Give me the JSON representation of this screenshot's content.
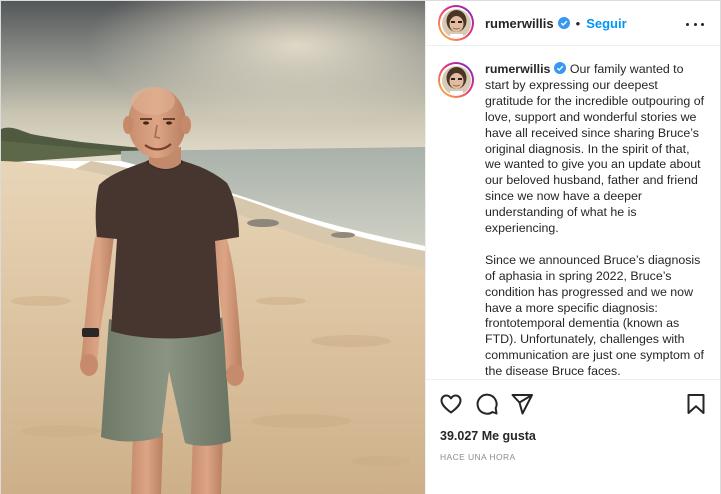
{
  "post": {
    "username": "rumerwillis",
    "follow_label": "Seguir",
    "separator": "•",
    "caption_paragraphs": [
      "Our family wanted to start by expressing our deepest gratitude for the incredible outpouring of love, support and wonderful stories we have all received since sharing Bruce’s original diagnosis. In the spirit of that, we wanted to give you an update about our beloved husband, father and friend since we now have a deeper understanding of what he is experiencing.",
      "Since we announced Bruce’s diagnosis of aphasia in spring 2022, Bruce’s condition has progressed and we now have a more specific diagnosis: frontotemporal dementia (known as FTD). Unfortunately, challenges with communication are just one symptom of the disease Bruce faces."
    ],
    "likes": "39.027 Me gusta",
    "timestamp": "HACE UNA HORA"
  },
  "icons": {
    "verified": "verified-badge-icon",
    "more": "more-options-icon",
    "like": "heart-icon",
    "comment": "comment-bubble-icon",
    "share": "paper-plane-icon",
    "save": "bookmark-icon"
  },
  "colors": {
    "link": "#0095f6",
    "verified": "#3897f0",
    "muted": "#8e8e8e"
  }
}
